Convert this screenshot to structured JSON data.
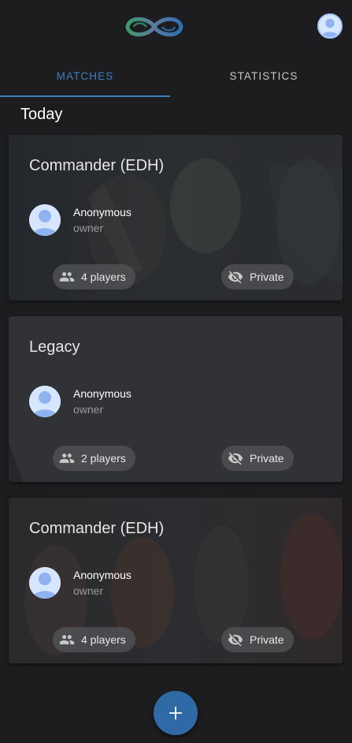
{
  "header": {
    "logo_icon": "infinity-logo-icon",
    "avatar_icon": "user-avatar-icon"
  },
  "tabs": [
    {
      "label": "MATCHES",
      "active": true
    },
    {
      "label": "STATISTICS",
      "active": false
    }
  ],
  "section_title": "Today",
  "matches": [
    {
      "format": "Commander (EDH)",
      "owner_name": "Anonymous",
      "owner_role": "owner",
      "players_label": "4 players",
      "visibility_label": "Private",
      "players_icon": "people-icon",
      "visibility_icon": "eye-off-icon"
    },
    {
      "format": "Legacy",
      "owner_name": "Anonymous",
      "owner_role": "owner",
      "players_label": "2 players",
      "visibility_label": "Private",
      "players_icon": "people-icon",
      "visibility_icon": "eye-off-icon"
    },
    {
      "format": "Commander (EDH)",
      "owner_name": "Anonymous",
      "owner_role": "owner",
      "players_label": "4 players",
      "visibility_label": "Private",
      "players_icon": "people-icon",
      "visibility_icon": "eye-off-icon"
    }
  ],
  "fab": {
    "label": "+",
    "icon": "plus-icon"
  },
  "colors": {
    "background": "#1d1d1f",
    "accent": "#3b7fc0",
    "card": "#2a2b2f",
    "chip": "#505054",
    "fab": "#2f6aa6"
  }
}
